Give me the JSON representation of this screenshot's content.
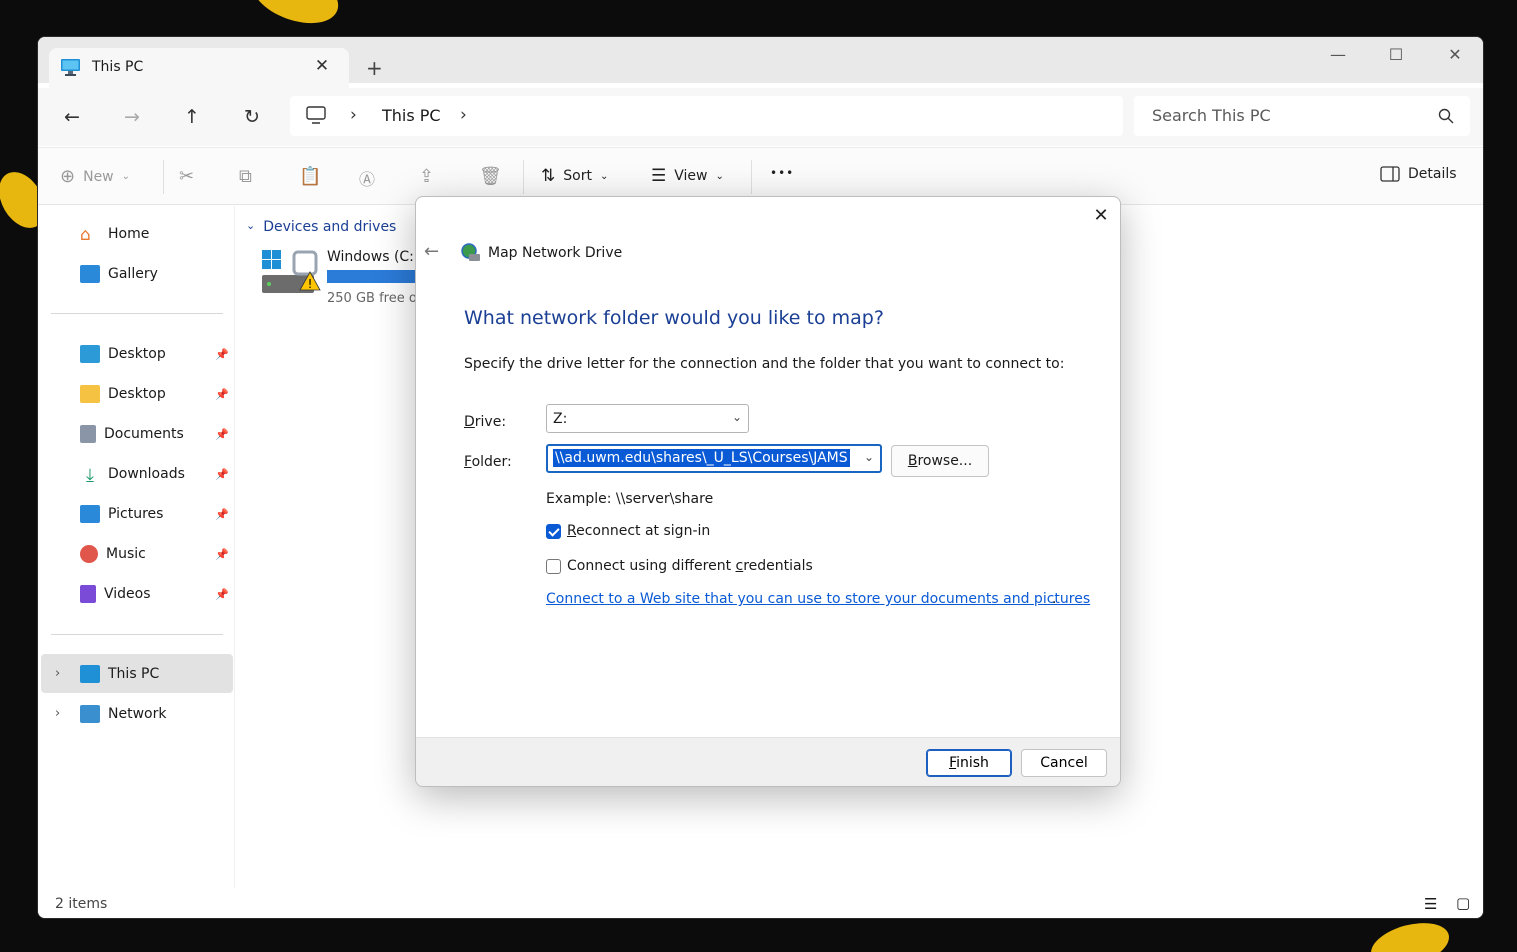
{
  "window": {
    "tab_title": "This PC",
    "new_tab_glyph": "+",
    "close_glyph": "✕"
  },
  "navbar": {
    "address": "This PC",
    "search_placeholder": "Search This PC"
  },
  "toolbar": {
    "new_label": "New",
    "sort_label": "Sort",
    "view_label": "View",
    "more_label": "•••",
    "details_label": "Details"
  },
  "sidebar": {
    "top": [
      {
        "label": "Home"
      },
      {
        "label": "Gallery"
      }
    ],
    "pinned": [
      {
        "label": "Desktop"
      },
      {
        "label": "Desktop"
      },
      {
        "label": "Documents"
      },
      {
        "label": "Downloads"
      },
      {
        "label": "Pictures"
      },
      {
        "label": "Music"
      },
      {
        "label": "Videos"
      }
    ],
    "tree": [
      {
        "label": "This PC"
      },
      {
        "label": "Network"
      }
    ]
  },
  "content": {
    "group_header": "Devices and drives",
    "drive_name": "Windows (C:)",
    "drive_free": "250 GB free o"
  },
  "status": {
    "items": "2 items"
  },
  "dialog": {
    "title": "Map Network Drive",
    "heading": "What network folder would you like to map?",
    "instruction": "Specify the drive letter for the connection and the folder that you want to connect to:",
    "drive_label_first": "D",
    "drive_label_rest": "rive:",
    "drive_value": "Z:",
    "folder_label_first": "F",
    "folder_label_rest": "older:",
    "folder_value": "\\\\ad.uwm.edu\\shares\\_U_LS\\Courses\\JAMS",
    "browse_first": "B",
    "browse_rest": "rowse...",
    "example": "Example: \\\\server\\share",
    "reconnect_first": "R",
    "reconnect_rest": "econnect at sign-in",
    "reconnect_checked": true,
    "creds_before": "Connect using different ",
    "creds_first": "c",
    "creds_rest": "redentials",
    "creds_checked": false,
    "link": "Connect to a Web site that you can use to store your documents and pictures",
    "link_dot": ".",
    "finish_first": "F",
    "finish_rest": "inish",
    "cancel": "Cancel"
  },
  "colors": {
    "accent": "#0a5ad5",
    "heading": "#1a3f94",
    "selection": "#e2e2e2"
  }
}
